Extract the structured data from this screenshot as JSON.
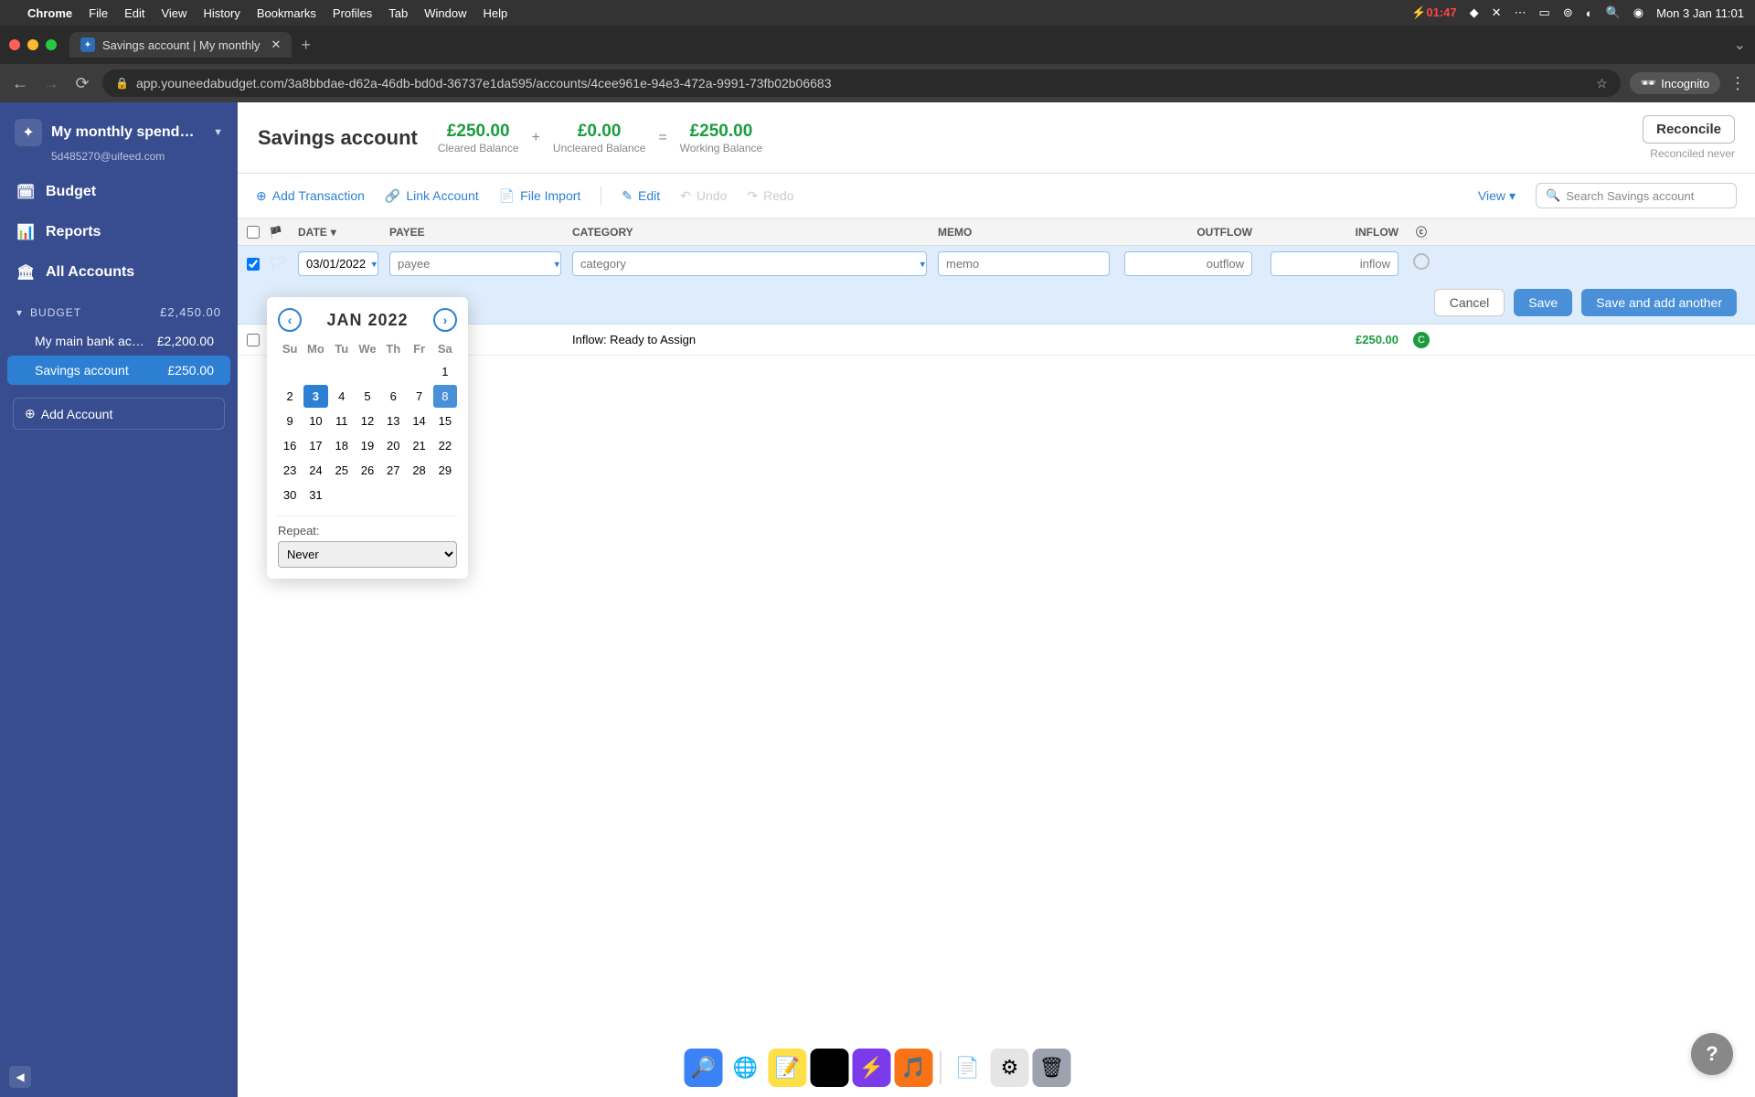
{
  "menubar": {
    "app": "Chrome",
    "items": [
      "File",
      "Edit",
      "View",
      "History",
      "Bookmarks",
      "Profiles",
      "Tab",
      "Window",
      "Help"
    ],
    "battery": "01:47",
    "clock": "Mon 3 Jan  11:01"
  },
  "browser": {
    "tab_title": "Savings account | My monthly",
    "url": "app.youneedabudget.com/3a8bbdae-d62a-46db-bd0d-36737e1da595/accounts/4cee961e-94e3-472a-9991-73fb02b06683",
    "incognito": "Incognito"
  },
  "sidebar": {
    "budget_name": "My monthly spend…",
    "email": "5d485270@uifeed.com",
    "nav": {
      "budget": "Budget",
      "reports": "Reports",
      "all_accounts": "All Accounts"
    },
    "section_label": "BUDGET",
    "section_total": "£2,450.00",
    "accounts": [
      {
        "name": "My main bank acc…",
        "amount": "£2,200.00"
      },
      {
        "name": "Savings account",
        "amount": "£250.00"
      }
    ],
    "add_account": "Add Account"
  },
  "header": {
    "account_name": "Savings account",
    "cleared_amt": "£250.00",
    "cleared_lbl": "Cleared Balance",
    "uncleared_amt": "£0.00",
    "uncleared_lbl": "Uncleared Balance",
    "working_amt": "£250.00",
    "working_lbl": "Working Balance",
    "reconcile_btn": "Reconcile",
    "reconcile_sub": "Reconciled never"
  },
  "toolbar": {
    "add": "Add Transaction",
    "link": "Link Account",
    "import": "File Import",
    "edit": "Edit",
    "undo": "Undo",
    "redo": "Redo",
    "view": "View",
    "search_placeholder": "Search Savings account"
  },
  "columns": {
    "date": "DATE",
    "payee": "PAYEE",
    "category": "CATEGORY",
    "memo": "MEMO",
    "outflow": "OUTFLOW",
    "inflow": "INFLOW"
  },
  "edit": {
    "date": "03/01/2022",
    "payee_ph": "payee",
    "category_ph": "category",
    "memo_ph": "memo",
    "outflow_ph": "outflow",
    "inflow_ph": "inflow",
    "cancel": "Cancel",
    "save": "Save",
    "save_add": "Save and add another"
  },
  "existing_row": {
    "category": "Inflow: Ready to Assign",
    "inflow": "£250.00"
  },
  "datepicker": {
    "title": "JAN 2022",
    "dow": [
      "Su",
      "Mo",
      "Tu",
      "We",
      "Th",
      "Fr",
      "Sa"
    ],
    "days": [
      [
        null,
        null,
        null,
        null,
        null,
        null,
        1
      ],
      [
        2,
        3,
        4,
        5,
        6,
        7,
        8
      ],
      [
        9,
        10,
        11,
        12,
        13,
        14,
        15
      ],
      [
        16,
        17,
        18,
        19,
        20,
        21,
        22
      ],
      [
        23,
        24,
        25,
        26,
        27,
        28,
        29
      ],
      [
        30,
        31,
        null,
        null,
        null,
        null,
        null
      ]
    ],
    "selected": 3,
    "hover": 8,
    "repeat_lbl": "Repeat:",
    "repeat_val": "Never"
  }
}
